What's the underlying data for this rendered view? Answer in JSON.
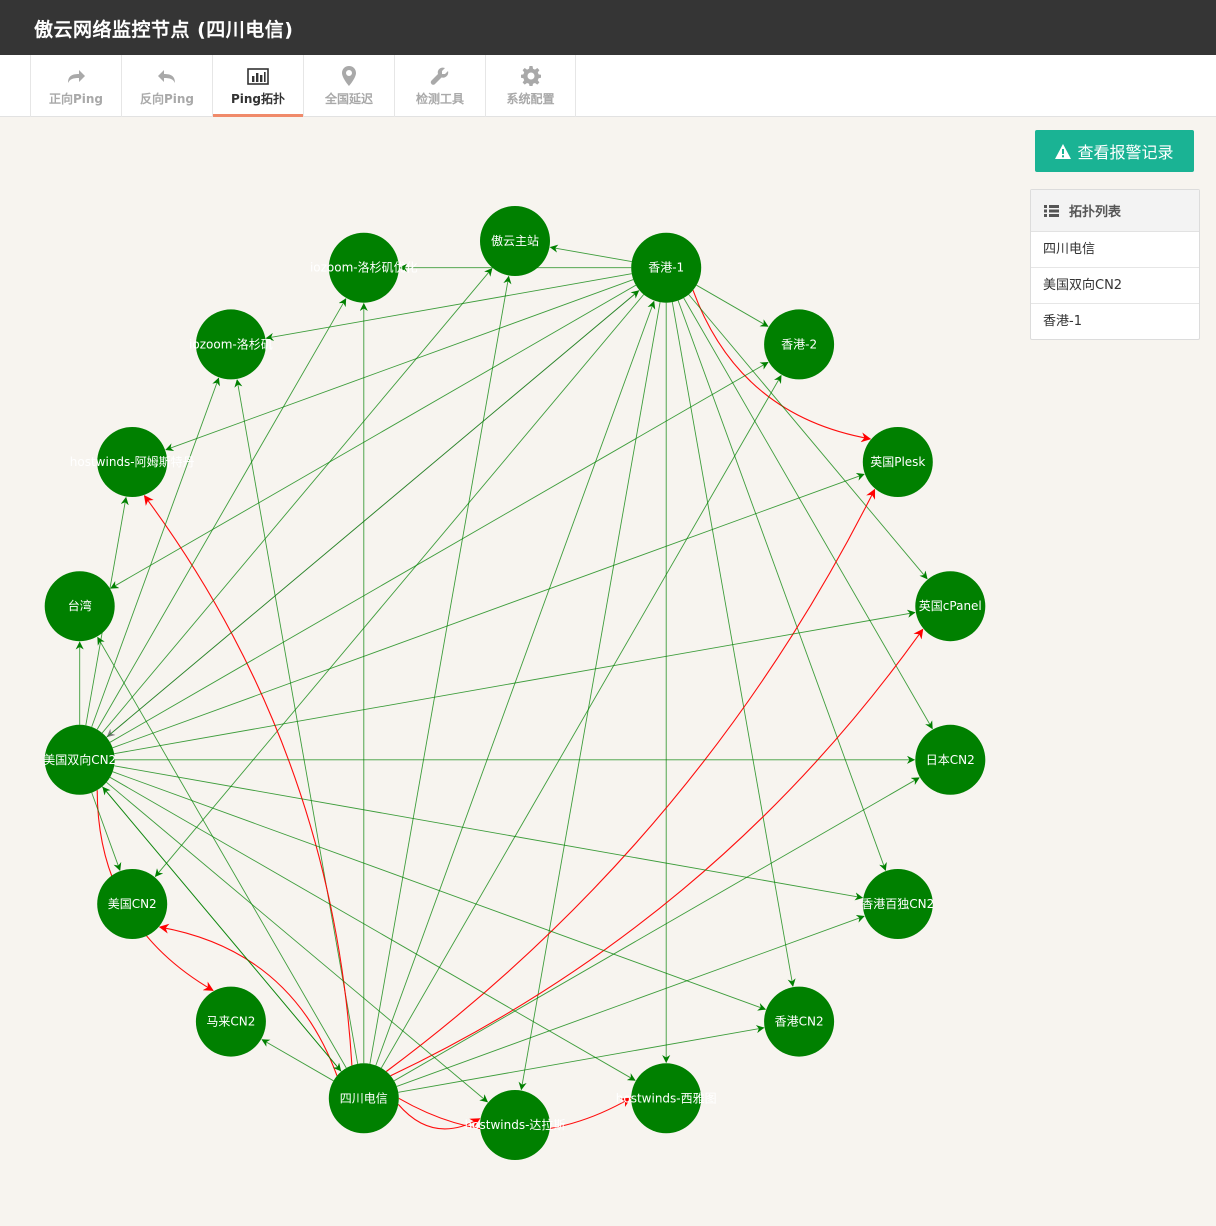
{
  "header": {
    "title": "傲云网络监控节点 (四川电信)"
  },
  "nav": [
    {
      "label": "正向Ping",
      "icon": "forward-arrow-icon",
      "active": false
    },
    {
      "label": "反向Ping",
      "icon": "reply-arrow-icon",
      "active": false
    },
    {
      "label": "Ping拓扑",
      "icon": "bar-chart-icon",
      "active": true
    },
    {
      "label": "全国延迟",
      "icon": "map-marker-icon",
      "active": false
    },
    {
      "label": "检测工具",
      "icon": "wrench-icon",
      "active": false
    },
    {
      "label": "系统配置",
      "icon": "gear-icon",
      "active": false
    }
  ],
  "alert_button": {
    "label": "查看报警记录",
    "icon": "warning-icon"
  },
  "topology_list": {
    "title": "拓扑列表",
    "icon": "list-icon",
    "items": [
      "四川电信",
      "美国双向CN2",
      "香港-1"
    ]
  },
  "colors": {
    "node": "#008000",
    "edge_ok": "#008000",
    "edge_alert": "#ff0000",
    "edge_neutral": "#808080",
    "accent": "#1ab394",
    "nav_active": "#f08a6a"
  },
  "graph": {
    "nodes": [
      {
        "id": "aoyun",
        "label": "傲云主站"
      },
      {
        "id": "hk1",
        "label": "香港-1"
      },
      {
        "id": "hk2",
        "label": "香港-2"
      },
      {
        "id": "ukplesk",
        "label": "英国Plesk"
      },
      {
        "id": "ukcpanel",
        "label": "英国cPanel"
      },
      {
        "id": "jpcn2",
        "label": "日本CN2"
      },
      {
        "id": "hkbd",
        "label": "香港百独CN2"
      },
      {
        "id": "hkcn2",
        "label": "香港CN2"
      },
      {
        "id": "seattle",
        "label": "hostwinds-西雅图"
      },
      {
        "id": "dallas",
        "label": "hostwinds-达拉斯"
      },
      {
        "id": "sichuan",
        "label": "四川电信"
      },
      {
        "id": "mycn2",
        "label": "马来CN2"
      },
      {
        "id": "uscn2",
        "label": "美国CN2"
      },
      {
        "id": "uscn2d",
        "label": "美国双向CN2"
      },
      {
        "id": "taiwan",
        "label": "台湾"
      },
      {
        "id": "ams",
        "label": "hostwinds-阿姆斯特丹"
      },
      {
        "id": "lajs",
        "label": "iozoom-洛杉矶"
      },
      {
        "id": "layh",
        "label": "iozoom-洛杉矶优化"
      }
    ],
    "edges": [
      {
        "from": "hk1",
        "to": "aoyun",
        "status": "ok"
      },
      {
        "from": "hk1",
        "to": "layh",
        "status": "ok"
      },
      {
        "from": "hk1",
        "to": "lajs",
        "status": "ok"
      },
      {
        "from": "hk1",
        "to": "hk2",
        "status": "ok"
      },
      {
        "from": "hk1",
        "to": "ukplesk",
        "status": "alert"
      },
      {
        "from": "hk1",
        "to": "ukcpanel",
        "status": "ok"
      },
      {
        "from": "hk1",
        "to": "jpcn2",
        "status": "ok"
      },
      {
        "from": "hk1",
        "to": "hkbd",
        "status": "ok"
      },
      {
        "from": "hk1",
        "to": "hkcn2",
        "status": "ok"
      },
      {
        "from": "hk1",
        "to": "seattle",
        "status": "ok"
      },
      {
        "from": "hk1",
        "to": "dallas",
        "status": "ok"
      },
      {
        "from": "hk1",
        "to": "ams",
        "status": "ok"
      },
      {
        "from": "hk1",
        "to": "taiwan",
        "status": "ok"
      },
      {
        "from": "hk1",
        "to": "uscn2d",
        "status": "neutral"
      },
      {
        "from": "hk1",
        "to": "uscn2",
        "status": "ok"
      },
      {
        "from": "sichuan",
        "to": "hk1",
        "status": "ok"
      },
      {
        "from": "sichuan",
        "to": "hk2",
        "status": "ok"
      },
      {
        "from": "sichuan",
        "to": "aoyun",
        "status": "ok"
      },
      {
        "from": "sichuan",
        "to": "layh",
        "status": "ok"
      },
      {
        "from": "sichuan",
        "to": "lajs",
        "status": "ok"
      },
      {
        "from": "sichuan",
        "to": "ams",
        "status": "alert"
      },
      {
        "from": "sichuan",
        "to": "uscn2",
        "status": "alert"
      },
      {
        "from": "sichuan",
        "to": "uscn2d",
        "status": "ok"
      },
      {
        "from": "sichuan",
        "to": "taiwan",
        "status": "ok"
      },
      {
        "from": "sichuan",
        "to": "mycn2",
        "status": "ok"
      },
      {
        "from": "sichuan",
        "to": "dallas",
        "status": "alert"
      },
      {
        "from": "sichuan",
        "to": "seattle",
        "status": "alert"
      },
      {
        "from": "sichuan",
        "to": "hkcn2",
        "status": "ok"
      },
      {
        "from": "sichuan",
        "to": "hkbd",
        "status": "ok"
      },
      {
        "from": "sichuan",
        "to": "jpcn2",
        "status": "ok"
      },
      {
        "from": "sichuan",
        "to": "ukcpanel",
        "status": "alert"
      },
      {
        "from": "sichuan",
        "to": "ukplesk",
        "status": "alert"
      },
      {
        "from": "uscn2d",
        "to": "taiwan",
        "status": "ok"
      },
      {
        "from": "uscn2d",
        "to": "ams",
        "status": "ok"
      },
      {
        "from": "uscn2d",
        "to": "lajs",
        "status": "ok"
      },
      {
        "from": "uscn2d",
        "to": "layh",
        "status": "ok"
      },
      {
        "from": "uscn2d",
        "to": "aoyun",
        "status": "ok"
      },
      {
        "from": "uscn2d",
        "to": "hk1",
        "status": "ok"
      },
      {
        "from": "uscn2d",
        "to": "hk2",
        "status": "ok"
      },
      {
        "from": "uscn2d",
        "to": "ukplesk",
        "status": "ok"
      },
      {
        "from": "uscn2d",
        "to": "ukcpanel",
        "status": "ok"
      },
      {
        "from": "uscn2d",
        "to": "jpcn2",
        "status": "ok"
      },
      {
        "from": "uscn2d",
        "to": "hkbd",
        "status": "ok"
      },
      {
        "from": "uscn2d",
        "to": "hkcn2",
        "status": "ok"
      },
      {
        "from": "uscn2d",
        "to": "seattle",
        "status": "ok"
      },
      {
        "from": "uscn2d",
        "to": "dallas",
        "status": "ok"
      },
      {
        "from": "uscn2d",
        "to": "sichuan",
        "status": "ok"
      },
      {
        "from": "uscn2d",
        "to": "mycn2",
        "status": "alert"
      },
      {
        "from": "uscn2d",
        "to": "uscn2",
        "status": "ok"
      }
    ]
  }
}
